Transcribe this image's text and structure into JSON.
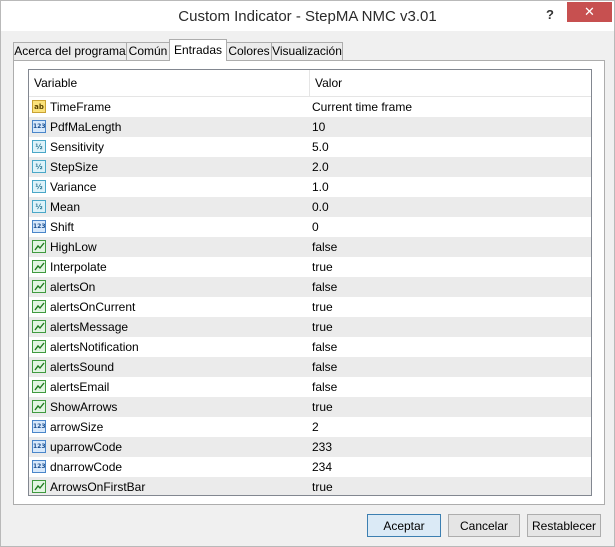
{
  "window": {
    "title": "Custom Indicator - StepMA NMC v3.01",
    "help_glyph": "?",
    "close_glyph": "✕"
  },
  "tabs": [
    {
      "label": "Acerca del programa"
    },
    {
      "label": "Común"
    },
    {
      "label": "Entradas",
      "active": true
    },
    {
      "label": "Colores"
    },
    {
      "label": "Visualización"
    }
  ],
  "grid": {
    "headers": {
      "variable": "Variable",
      "value": "Valor"
    },
    "rows": [
      {
        "icon": "string-icon",
        "glyph": "ab",
        "name": "TimeFrame",
        "value": "Current time frame"
      },
      {
        "icon": "integer-icon",
        "glyph": "123",
        "name": "PdfMaLength",
        "value": "10"
      },
      {
        "icon": "double-icon",
        "glyph": "½",
        "name": "Sensitivity",
        "value": "5.0"
      },
      {
        "icon": "double-icon",
        "glyph": "½",
        "name": "StepSize",
        "value": "2.0"
      },
      {
        "icon": "double-icon",
        "glyph": "½",
        "name": "Variance",
        "value": "1.0"
      },
      {
        "icon": "double-icon",
        "glyph": "½",
        "name": "Mean",
        "value": "0.0"
      },
      {
        "icon": "integer-icon",
        "glyph": "123",
        "name": "Shift",
        "value": "0"
      },
      {
        "icon": "boolean-icon",
        "glyph": "",
        "name": "HighLow",
        "value": "false"
      },
      {
        "icon": "boolean-icon",
        "glyph": "",
        "name": "Interpolate",
        "value": "true"
      },
      {
        "icon": "boolean-icon",
        "glyph": "",
        "name": "alertsOn",
        "value": "false"
      },
      {
        "icon": "boolean-icon",
        "glyph": "",
        "name": "alertsOnCurrent",
        "value": "true"
      },
      {
        "icon": "boolean-icon",
        "glyph": "",
        "name": "alertsMessage",
        "value": "true"
      },
      {
        "icon": "boolean-icon",
        "glyph": "",
        "name": "alertsNotification",
        "value": "false"
      },
      {
        "icon": "boolean-icon",
        "glyph": "",
        "name": "alertsSound",
        "value": "false"
      },
      {
        "icon": "boolean-icon",
        "glyph": "",
        "name": "alertsEmail",
        "value": "false"
      },
      {
        "icon": "boolean-icon",
        "glyph": "",
        "name": "ShowArrows",
        "value": "true"
      },
      {
        "icon": "integer-icon",
        "glyph": "123",
        "name": "arrowSize",
        "value": "2"
      },
      {
        "icon": "integer-icon",
        "glyph": "123",
        "name": "uparrowCode",
        "value": "233"
      },
      {
        "icon": "integer-icon",
        "glyph": "123",
        "name": "dnarrowCode",
        "value": "234"
      },
      {
        "icon": "boolean-icon",
        "glyph": "",
        "name": "ArrowsOnFirstBar",
        "value": "true"
      }
    ]
  },
  "buttons": {
    "accept": "Aceptar",
    "cancel": "Cancelar",
    "reset": "Restablecer"
  }
}
